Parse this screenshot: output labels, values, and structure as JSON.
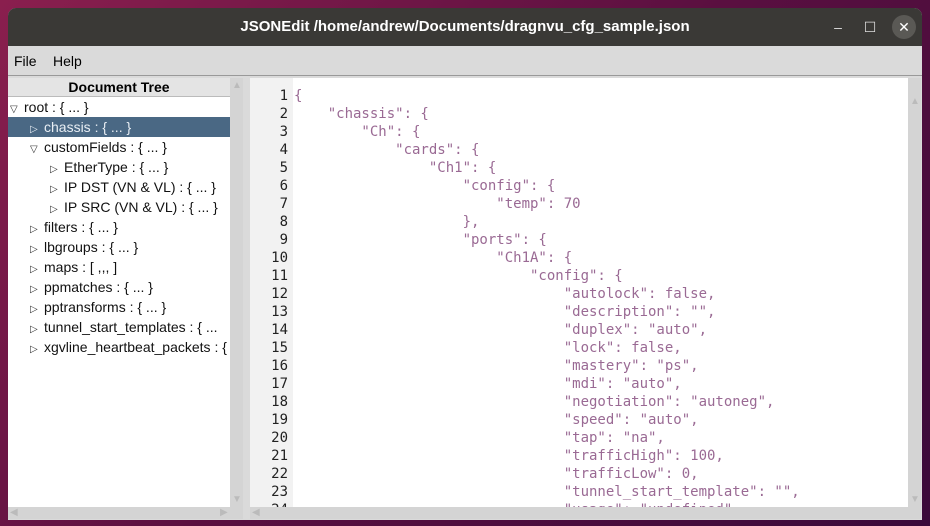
{
  "window": {
    "title": "JSONEdit /home/andrew/Documents/dragnvu_cfg_sample.json",
    "minimize": "–",
    "maximize": "☐",
    "close": "✕"
  },
  "menu": [
    {
      "label": "File"
    },
    {
      "label": "Help"
    }
  ],
  "tree": {
    "header": "Document Tree",
    "items": [
      {
        "label": "root : { ... }",
        "depth": 0,
        "expanded": true
      },
      {
        "label": "chassis : { ... }",
        "depth": 1,
        "expanded": false,
        "selected": true
      },
      {
        "label": "customFields : { ... }",
        "depth": 1,
        "expanded": true
      },
      {
        "label": "EtherType : { ... }",
        "depth": 2,
        "expanded": false
      },
      {
        "label": "IP DST (VN & VL) : { ... }",
        "depth": 2,
        "expanded": false
      },
      {
        "label": "IP SRC (VN & VL) : { ... }",
        "depth": 2,
        "expanded": false
      },
      {
        "label": "filters : { ... }",
        "depth": 1,
        "expanded": false
      },
      {
        "label": "lbgroups : { ... }",
        "depth": 1,
        "expanded": false
      },
      {
        "label": "maps : [ ,,, ]",
        "depth": 1,
        "expanded": false
      },
      {
        "label": "ppmatches : { ... }",
        "depth": 1,
        "expanded": false
      },
      {
        "label": "pptransforms : { ... }",
        "depth": 1,
        "expanded": false
      },
      {
        "label": "tunnel_start_templates : { ...",
        "depth": 1,
        "expanded": false
      },
      {
        "label": "xgvline_heartbeat_packets : { ... }",
        "depth": 1,
        "expanded": false
      }
    ]
  },
  "editor": {
    "lines": [
      "{",
      "    \"chassis\": {",
      "        \"Ch\": {",
      "            \"cards\": {",
      "                \"Ch1\": {",
      "                    \"config\": {",
      "                        \"temp\": 70",
      "                    },",
      "                    \"ports\": {",
      "                        \"Ch1A\": {",
      "                            \"config\": {",
      "                                \"autolock\": false,",
      "                                \"description\": \"\",",
      "                                \"duplex\": \"auto\",",
      "                                \"lock\": false,",
      "                                \"mastery\": \"ps\",",
      "                                \"mdi\": \"auto\",",
      "                                \"negotiation\": \"autoneg\",",
      "                                \"speed\": \"auto\",",
      "                                \"tap\": \"na\",",
      "                                \"trafficHigh\": 100,",
      "                                \"trafficLow\": 0,",
      "                                \"tunnel_start_template\": \"\",",
      "                                \"usage\": \"undefined\""
    ]
  }
}
